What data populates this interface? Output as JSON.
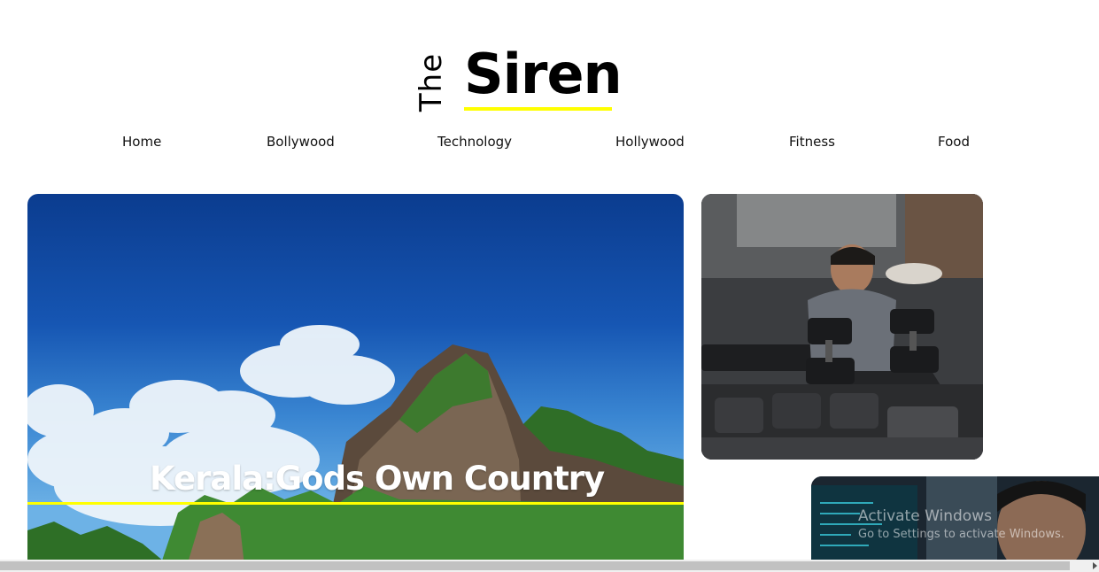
{
  "logo": {
    "prefix": "The",
    "name": "Siren",
    "accent_color": "#ffff00"
  },
  "nav": {
    "items": [
      {
        "label": "Home"
      },
      {
        "label": "Bollywood"
      },
      {
        "label": "Technology"
      },
      {
        "label": "Hollywood"
      },
      {
        "label": "Fitness"
      },
      {
        "label": "Food"
      }
    ]
  },
  "featured": {
    "title": "Kerala:Gods Own Country",
    "image": "kerala-mountains-sky-photo"
  },
  "side_cards": [
    {
      "image": "man-lifting-dumbbells-gym-photo"
    },
    {
      "image": "man-at-computer-screens-photo"
    }
  ],
  "watermark": {
    "line1": "Activate Windows",
    "line2": "Go to Settings to activate Windows."
  }
}
